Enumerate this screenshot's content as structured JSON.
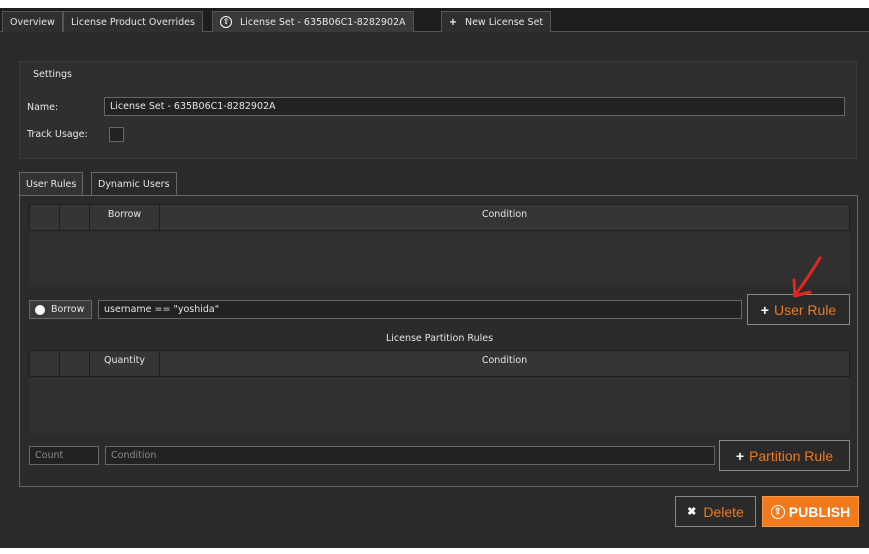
{
  "tabs": [
    {
      "label": "Overview"
    },
    {
      "label": "License Product Overrides"
    },
    {
      "label": "License Set - 635B06C1-8282902A",
      "icon": "publish-circle-icon"
    },
    {
      "label": "New License Set",
      "icon": "plus-icon"
    }
  ],
  "settings": {
    "title": "Settings",
    "name_label": "Name:",
    "name_value": "License Set - 635B06C1-8282902A",
    "track_usage_label": "Track Usage:",
    "track_usage_checked": false
  },
  "subtabs": [
    {
      "label": "User Rules"
    },
    {
      "label": "Dynamic Users"
    }
  ],
  "user_rules": {
    "columns": [
      "",
      "",
      "Borrow",
      "Condition"
    ],
    "rows": [],
    "borrow_toggle_label": "Borrow",
    "condition_value": "username == \"yoshida\"",
    "add_button_label": "User Rule"
  },
  "partition_rules": {
    "title": "License Partition Rules",
    "columns": [
      "",
      "",
      "Quantity",
      "Condition"
    ],
    "rows": [],
    "count_placeholder": "Count",
    "condition_placeholder": "Condition",
    "add_button_label": "Partition Rule"
  },
  "actions": {
    "delete_label": "Delete",
    "publish_label": "PUBLISH"
  },
  "colors": {
    "accent": "#f07a1c",
    "annotation_arrow": "#e0281e",
    "background": "#2a2a2a"
  }
}
